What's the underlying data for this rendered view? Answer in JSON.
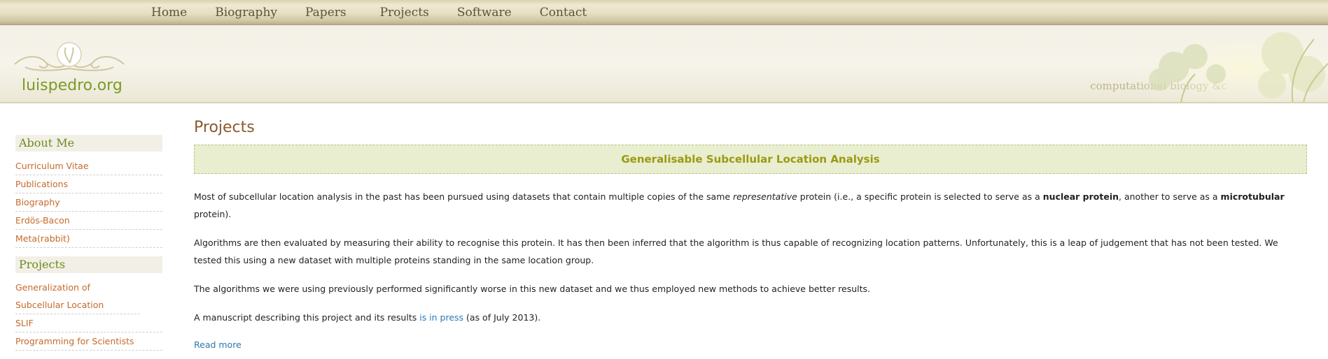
{
  "nav": {
    "items": [
      "Home",
      "Biography",
      "Papers",
      "Projects",
      "Software",
      "Contact"
    ]
  },
  "header": {
    "site_name": "luispedro.org",
    "tagline": "computational biology &c",
    "logo_icon": "ornamental-swirl-icon"
  },
  "sidebar": {
    "sections": [
      {
        "title": "About Me",
        "items": [
          "Curriculum Vitae",
          "Publications",
          "Biography",
          "Erdös-Bacon",
          "Meta(rabbit)"
        ]
      },
      {
        "title": "Projects",
        "items": [
          "Generalization of Subcellular Location",
          "SLIF",
          "Programming for Scientists"
        ]
      }
    ]
  },
  "main": {
    "title": "Projects",
    "project_title": "Generalisable Subcellular Location Analysis",
    "p1": {
      "a": "Most of subcellular location analysis in the past has been pursued using datasets that contain multiple copies of the same ",
      "em": "representative",
      "b": " protein (i.e., a specific protein is selected to serve as a ",
      "strong1": "nuclear protein",
      "c": ", another to serve as a ",
      "strong2": "microtubular",
      "d": " protein)."
    },
    "p2": "Algorithms are then evaluated by measuring their ability to recognise this protein. It has then been inferred that the algorithm is thus capable of recognizing location patterns. Unfortunately, this is a leap of judgement that has not been tested. We tested this using a new dataset with multiple proteins standing in the same location group.",
    "p3": "The algorithms we were using previously performed significantly worse in this new dataset and we thus employed new methods to achieve better results.",
    "p4": {
      "a": "A manuscript describing this project and its results ",
      "link": "is in press",
      "b": " (as of July 2013)."
    },
    "read_more": "Read more"
  },
  "colors": {
    "accent_green": "#7d9a25",
    "heading_brown": "#8a5a2c",
    "sidebar_link": "#c46a2b",
    "link_blue": "#2a7ab0"
  }
}
